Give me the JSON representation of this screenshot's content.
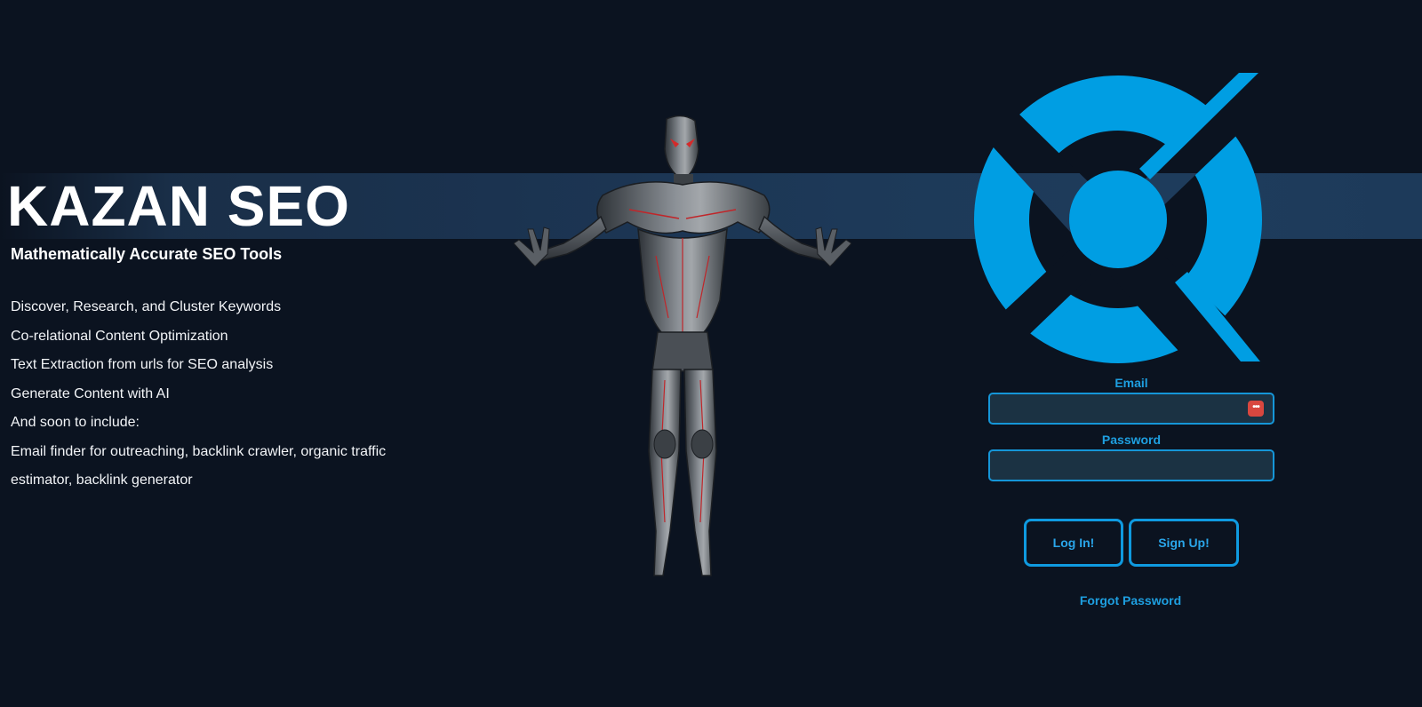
{
  "brand": {
    "title": "KAZAN SEO",
    "tagline": "Mathematically Accurate SEO Tools"
  },
  "features": [
    "Discover, Research, and Cluster Keywords",
    "Co-relational Content Optimization",
    "Text Extraction from urls for SEO analysis",
    "Generate Content with AI",
    "And soon to include:",
    "Email finder for outreaching, backlink crawler, organic traffic estimator, backlink generator"
  ],
  "login": {
    "email_label": "Email",
    "email_value": "",
    "password_label": "Password",
    "password_value": "",
    "login_button": "Log In!",
    "signup_button": "Sign Up!",
    "forgot_link": "Forgot Password"
  },
  "icons": {
    "password_manager": "password-manager-icon",
    "logo": "kazan-logo-icon",
    "figure": "armored-figure-illustration"
  },
  "colors": {
    "background": "#0b1320",
    "accent": "#0f9ae0",
    "logo_blue": "#009ee3",
    "band": "#1d3958",
    "input_bg": "#1b3243"
  }
}
